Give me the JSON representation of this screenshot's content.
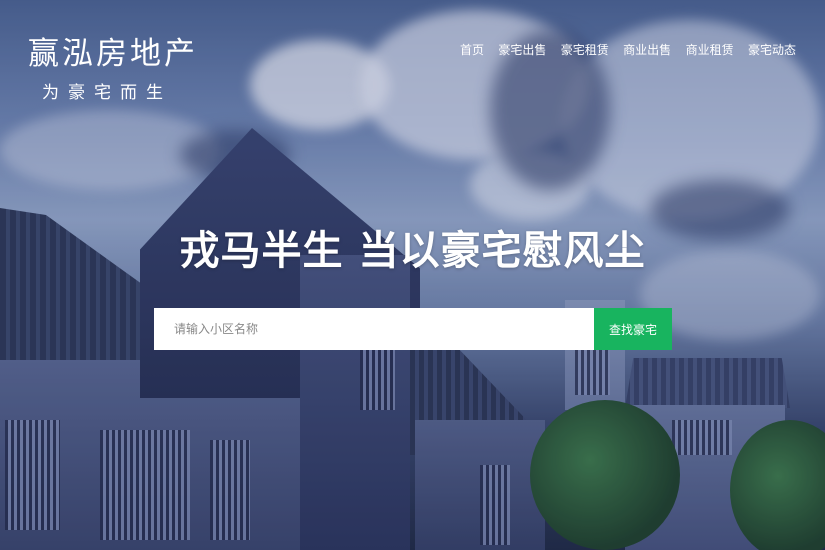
{
  "brand": {
    "name": "赢泓房地产",
    "slogan": "为豪宅而生"
  },
  "nav": {
    "items": [
      {
        "label": "首页"
      },
      {
        "label": "豪宅出售"
      },
      {
        "label": "豪宅租赁"
      },
      {
        "label": "商业出售"
      },
      {
        "label": "商业租赁"
      },
      {
        "label": "豪宅动态"
      }
    ]
  },
  "hero": {
    "headline": "戎马半生 当以豪宅慰风尘"
  },
  "search": {
    "placeholder": "请输入小区名称",
    "button_label": "查找豪宅"
  },
  "colors": {
    "accent": "#18b45f",
    "text_on_hero": "#ffffff"
  }
}
